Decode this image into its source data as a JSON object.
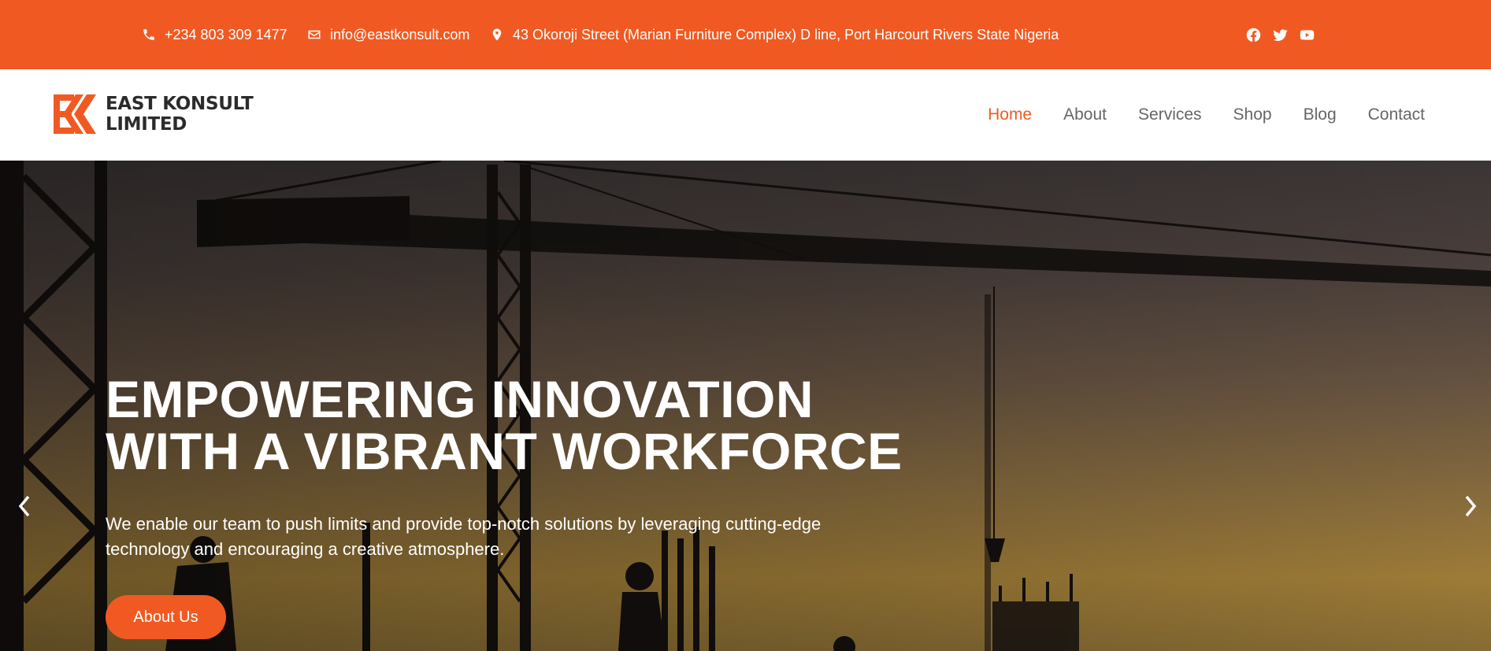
{
  "topbar": {
    "phone": "+234 803 309 1477",
    "email": "info@eastkonsult.com",
    "address": "43 Okoroji Street (Marian Furniture Complex) D line, Port Harcourt Rivers State Nigeria",
    "socials": [
      "facebook-icon",
      "twitter-icon",
      "youtube-icon"
    ],
    "background_color": "#F05A22"
  },
  "logo": {
    "line1": "EAST KONSULT",
    "line2": "LIMITED",
    "accent_color": "#F05A22"
  },
  "nav": {
    "items": [
      {
        "label": "Home",
        "active": true
      },
      {
        "label": "About",
        "active": false
      },
      {
        "label": "Services",
        "active": false
      },
      {
        "label": "Shop",
        "active": false
      },
      {
        "label": "Blog",
        "active": false
      },
      {
        "label": "Contact",
        "active": false
      }
    ],
    "active_color": "#F05A22",
    "text_color": "#666666"
  },
  "hero": {
    "title_line1": "EMPOWERING INNOVATION",
    "title_line2": "WITH A VIBRANT WORKFORCE",
    "text": "We enable our team to push limits and provide top-notch solutions by leveraging cutting-edge technology and encouraging a creative atmosphere.",
    "button_label": "About Us",
    "prev_icon": "chevron-left-icon",
    "next_icon": "chevron-right-icon"
  }
}
